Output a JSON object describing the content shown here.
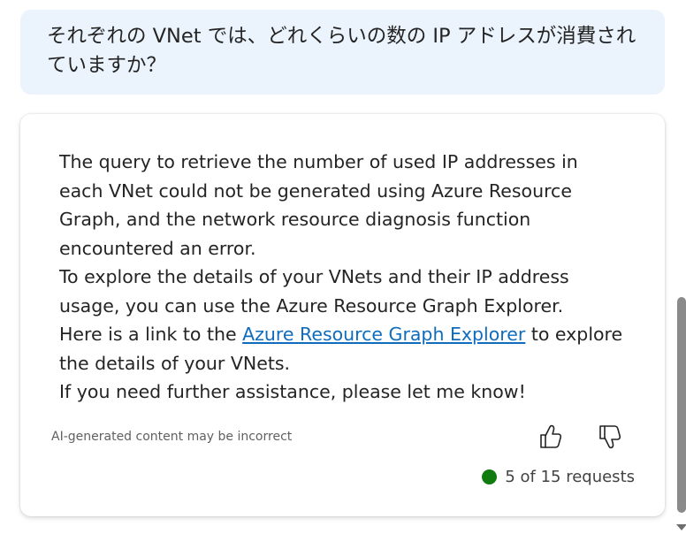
{
  "user_message": "それぞれの VNet では、どれくらいの数の IP アドレスが消費されていますか？",
  "response": {
    "paragraph_1": "The query to retrieve the number of used IP addresses in each VNet could not be generated using Azure Resource Graph, and the network resource diagnosis function encountered an error.",
    "paragraph_2": "To explore the details of your VNets and their IP address usage, you can use the Azure Resource Graph Explorer.",
    "paragraph_3_before": "Here is a link to the ",
    "link_text": "Azure Resource Graph Explorer",
    "paragraph_3_after": " to explore the details of your VNets.",
    "paragraph_4": "If you need further assistance, please let me know!"
  },
  "disclaimer": "AI-generated content may be incorrect",
  "feedback": {
    "like_icon": "thumbs-up-icon",
    "dislike_icon": "thumbs-down-icon"
  },
  "requests_status": {
    "text": "5 of 15 requests",
    "dot_color": "#107c10"
  },
  "colors": {
    "user_bubble": "#ebf3fc",
    "link": "#0f6cbd"
  }
}
